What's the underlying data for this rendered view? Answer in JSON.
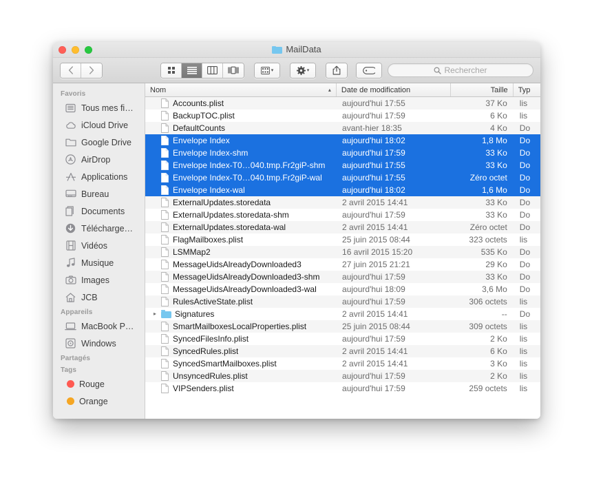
{
  "window": {
    "title": "MailData",
    "traffic_lights": [
      "close",
      "minimize",
      "zoom"
    ]
  },
  "toolbar": {
    "back_label": "‹",
    "forward_label": "›",
    "views": [
      "icon-view",
      "list-view",
      "column-view",
      "coverflow-view"
    ],
    "active_view": "list-view",
    "arrange_label": "arrange",
    "action_label": "action",
    "share_label": "share",
    "tag_label": "tag",
    "caret": "▾"
  },
  "search": {
    "placeholder": "Rechercher",
    "value": ""
  },
  "sidebar": {
    "sections": [
      {
        "header": "Favoris",
        "items": [
          {
            "label": "Tous mes fi…",
            "icon": "all-my-files-icon"
          },
          {
            "label": "iCloud Drive",
            "icon": "cloud-icon"
          },
          {
            "label": "Google Drive",
            "icon": "folder-icon"
          },
          {
            "label": "AirDrop",
            "icon": "airdrop-icon"
          },
          {
            "label": "Applications",
            "icon": "applications-icon"
          },
          {
            "label": "Bureau",
            "icon": "desktop-icon"
          },
          {
            "label": "Documents",
            "icon": "documents-icon"
          },
          {
            "label": "Télécharge…",
            "icon": "downloads-icon"
          },
          {
            "label": "Vidéos",
            "icon": "movies-icon"
          },
          {
            "label": "Musique",
            "icon": "music-icon"
          },
          {
            "label": "Images",
            "icon": "pictures-icon"
          },
          {
            "label": "JCB",
            "icon": "home-icon"
          }
        ]
      },
      {
        "header": "Appareils",
        "items": [
          {
            "label": "MacBook P…",
            "icon": "laptop-icon"
          },
          {
            "label": "Windows",
            "icon": "disk-icon"
          }
        ]
      },
      {
        "header": "Partagés",
        "items": []
      },
      {
        "header": "Tags",
        "items": [
          {
            "label": "Rouge",
            "icon": "tag-dot",
            "color": "#ff5a52"
          },
          {
            "label": "Orange",
            "icon": "tag-dot",
            "color": "#f5a623"
          }
        ]
      }
    ]
  },
  "filelist": {
    "columns": [
      {
        "key": "name",
        "label": "Nom",
        "sorted": true,
        "sort_arrow": "▴"
      },
      {
        "key": "date",
        "label": "Date de modification"
      },
      {
        "key": "size",
        "label": "Taille"
      },
      {
        "key": "type",
        "label": "Typ"
      }
    ],
    "rows": [
      {
        "name": "Accounts.plist",
        "date": "aujourd'hui 17:55",
        "size": "37 Ko",
        "type": "lis",
        "kind": "file",
        "selected": false
      },
      {
        "name": "BackupTOC.plist",
        "date": "aujourd'hui 17:59",
        "size": "6 Ko",
        "type": "lis",
        "kind": "file",
        "selected": false
      },
      {
        "name": "DefaultCounts",
        "date": "avant-hier 18:35",
        "size": "4 Ko",
        "type": "Do",
        "kind": "file",
        "selected": false
      },
      {
        "name": "Envelope Index",
        "date": "aujourd'hui 18:02",
        "size": "1,8 Mo",
        "type": "Do",
        "kind": "file",
        "selected": true
      },
      {
        "name": "Envelope Index-shm",
        "date": "aujourd'hui 17:59",
        "size": "33 Ko",
        "type": "Do",
        "kind": "file",
        "selected": true
      },
      {
        "name": "Envelope Index-T0…040.tmp.Fr2giP-shm",
        "date": "aujourd'hui 17:55",
        "size": "33 Ko",
        "type": "Do",
        "kind": "file",
        "selected": true
      },
      {
        "name": "Envelope Index-T0…040.tmp.Fr2giP-wal",
        "date": "aujourd'hui 17:55",
        "size": "Zéro octet",
        "type": "Do",
        "kind": "file",
        "selected": true
      },
      {
        "name": "Envelope Index-wal",
        "date": "aujourd'hui 18:02",
        "size": "1,6 Mo",
        "type": "Do",
        "kind": "file",
        "selected": true
      },
      {
        "name": "ExternalUpdates.storedata",
        "date": "2 avril 2015 14:41",
        "size": "33 Ko",
        "type": "Do",
        "kind": "file",
        "selected": false
      },
      {
        "name": "ExternalUpdates.storedata-shm",
        "date": "aujourd'hui 17:59",
        "size": "33 Ko",
        "type": "Do",
        "kind": "file",
        "selected": false
      },
      {
        "name": "ExternalUpdates.storedata-wal",
        "date": "2 avril 2015 14:41",
        "size": "Zéro octet",
        "type": "Do",
        "kind": "file",
        "selected": false
      },
      {
        "name": "FlagMailboxes.plist",
        "date": "25 juin 2015 08:44",
        "size": "323 octets",
        "type": "lis",
        "kind": "file",
        "selected": false
      },
      {
        "name": "LSMMap2",
        "date": "16 avril 2015 15:20",
        "size": "535 Ko",
        "type": "Do",
        "kind": "file",
        "selected": false
      },
      {
        "name": "MessageUidsAlreadyDownloaded3",
        "date": "27 juin 2015 21:21",
        "size": "29 Ko",
        "type": "Do",
        "kind": "file",
        "selected": false
      },
      {
        "name": "MessageUidsAlreadyDownloaded3-shm",
        "date": "aujourd'hui 17:59",
        "size": "33 Ko",
        "type": "Do",
        "kind": "file",
        "selected": false
      },
      {
        "name": "MessageUidsAlreadyDownloaded3-wal",
        "date": "aujourd'hui 18:09",
        "size": "3,6 Mo",
        "type": "Do",
        "kind": "file",
        "selected": false
      },
      {
        "name": "RulesActiveState.plist",
        "date": "aujourd'hui 17:59",
        "size": "306 octets",
        "type": "lis",
        "kind": "file",
        "selected": false
      },
      {
        "name": "Signatures",
        "date": "2 avril 2015 14:41",
        "size": "--",
        "type": "Do",
        "kind": "folder",
        "selected": false,
        "disclosure": "▸"
      },
      {
        "name": "SmartMailboxesLocalProperties.plist",
        "date": "25 juin 2015 08:44",
        "size": "309 octets",
        "type": "lis",
        "kind": "file",
        "selected": false
      },
      {
        "name": "SyncedFilesInfo.plist",
        "date": "aujourd'hui 17:59",
        "size": "2 Ko",
        "type": "lis",
        "kind": "file",
        "selected": false
      },
      {
        "name": "SyncedRules.plist",
        "date": "2 avril 2015 14:41",
        "size": "6 Ko",
        "type": "lis",
        "kind": "file",
        "selected": false
      },
      {
        "name": "SyncedSmartMailboxes.plist",
        "date": "2 avril 2015 14:41",
        "size": "3 Ko",
        "type": "lis",
        "kind": "file",
        "selected": false
      },
      {
        "name": "UnsyncedRules.plist",
        "date": "aujourd'hui 17:59",
        "size": "2 Ko",
        "type": "lis",
        "kind": "file",
        "selected": false
      },
      {
        "name": "VIPSenders.plist",
        "date": "aujourd'hui 17:59",
        "size": "259 octets",
        "type": "lis",
        "kind": "file",
        "selected": false
      }
    ]
  },
  "colors": {
    "selection_blue": "#1b71e0",
    "sidebar_bg": "#ececec",
    "folder_blue": "#76c7ef"
  }
}
